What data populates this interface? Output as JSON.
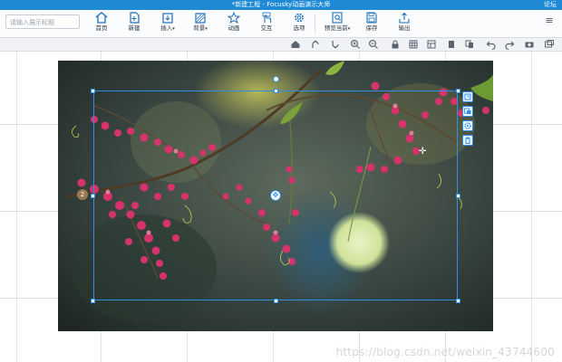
{
  "window": {
    "title": "*新建工程 - Focusky动画演示大师",
    "forum_link": "论坛"
  },
  "search": {
    "placeholder": "请输入展示标题"
  },
  "ribbon": {
    "buttons": [
      {
        "label": "首页",
        "icon": "home-icon"
      },
      {
        "label": "新建",
        "icon": "new-file-icon"
      },
      {
        "label": "插入",
        "icon": "insert-icon",
        "dropdown": true
      },
      {
        "label": "背景",
        "icon": "background-icon",
        "dropdown": true
      },
      {
        "label": "动画",
        "icon": "star-animation-icon"
      },
      {
        "label": "交互",
        "icon": "interaction-icon"
      },
      {
        "label": "选项",
        "icon": "gear-icon"
      },
      {
        "label": "预览当前",
        "icon": "preview-icon",
        "dropdown": true
      },
      {
        "label": "保存",
        "icon": "save-icon"
      },
      {
        "label": "输出",
        "icon": "export-icon"
      }
    ]
  },
  "toolbar2": {
    "tools": [
      "home-icon",
      "align-up-icon",
      "align-down-icon",
      "zoom-in-icon",
      "zoom-out-icon",
      "lock-icon",
      "grid-icon",
      "layout-icon",
      "pages-icon",
      "copy-icon",
      "paste-icon",
      "undo-icon",
      "redo-icon",
      "camera-icon",
      "window-icon"
    ]
  },
  "canvas": {
    "frame_badge": "2",
    "side_tools": [
      "edit-frame-icon",
      "replace-image-icon",
      "settings-icon",
      "delete-icon"
    ]
  },
  "watermark": "https://blog.csdn.net/weixin_43744600",
  "colors": {
    "accent": "#1e8ad6",
    "selection": "#2f8fe6"
  }
}
